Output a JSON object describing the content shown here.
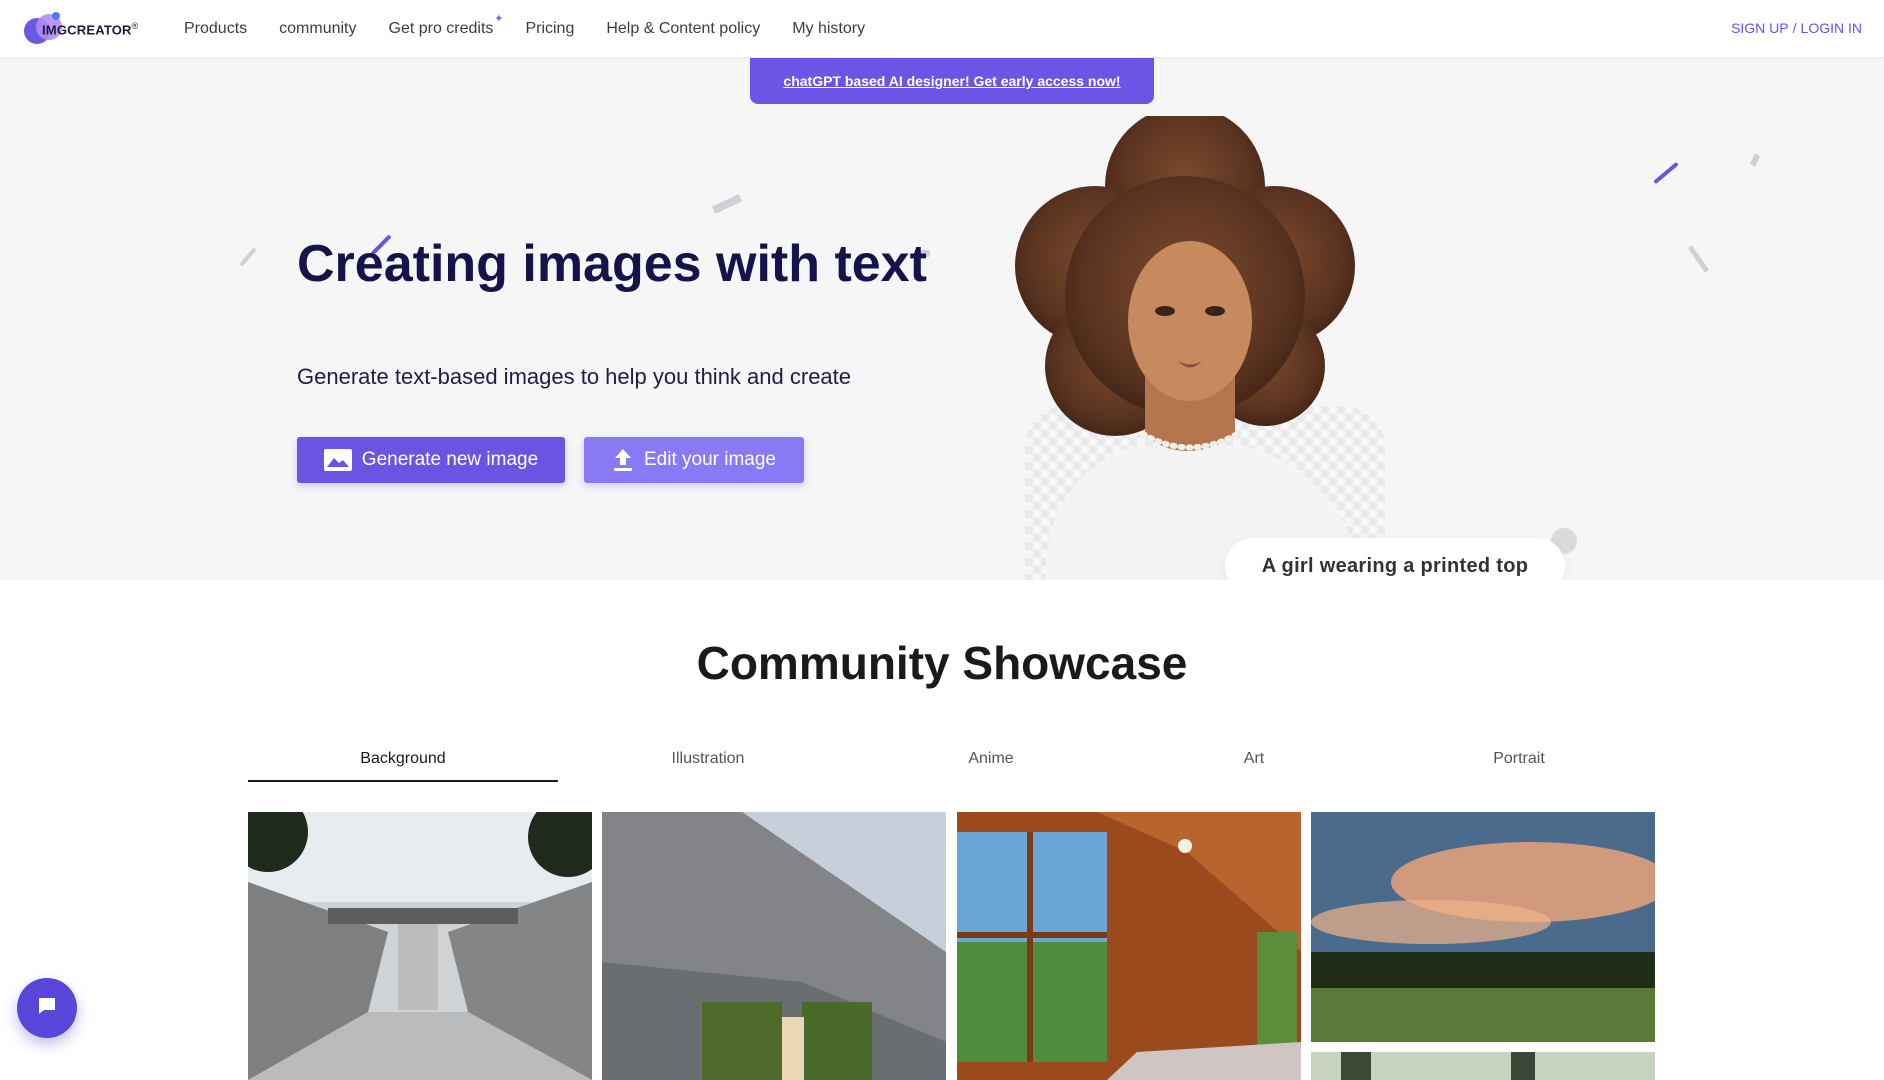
{
  "header": {
    "logo_text": "IMGCREATOR",
    "logo_mark": "®",
    "nav": [
      {
        "label": "Products"
      },
      {
        "label": "community"
      },
      {
        "label": "Get pro credits"
      },
      {
        "label": "Pricing"
      },
      {
        "label": "Help & Content policy"
      },
      {
        "label": "My history"
      }
    ],
    "signup_label": "SIGN UP",
    "login_label": "LOGIN IN",
    "auth_separator": "/"
  },
  "promo": {
    "label": "chatGPT based AI designer! Get early access now!"
  },
  "hero": {
    "title": "Creating images with text",
    "subtitle": "Generate text-based images to help you think and create",
    "generate_label": "Generate new image",
    "edit_label": "Edit your image",
    "caption": "A girl wearing a printed top"
  },
  "showcase": {
    "title": "Community Showcase",
    "tabs": [
      {
        "label": "Background",
        "active": true
      },
      {
        "label": "Illustration",
        "active": false
      },
      {
        "label": "Anime",
        "active": false
      },
      {
        "label": "Art",
        "active": false
      },
      {
        "label": "Portrait",
        "active": false
      }
    ]
  },
  "colors": {
    "brand": "#6a55e3",
    "brand_light": "#8a79f5",
    "title": "#16124a"
  },
  "icons": [
    "image-icon",
    "upload-icon",
    "chat-icon",
    "sparkle-icon"
  ]
}
